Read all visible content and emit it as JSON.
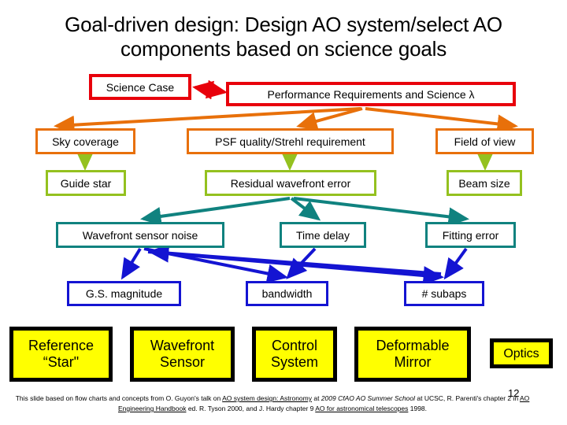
{
  "title": {
    "accent": "Goal-driven design:",
    "rest": " Design AO system/select AO components based on science goals"
  },
  "colors": {
    "red": "#E8000B",
    "orange": "#E8700A",
    "lime": "#94C11F",
    "teal": "#10827F",
    "blue": "#1414D2",
    "yellow_fill": "#FFFF00",
    "black": "#000000",
    "title_accent": "#8B1A12"
  },
  "flow": {
    "row1": [
      {
        "label": "Science Case",
        "color": "red"
      },
      {
        "label": "Performance Requirements and Science λ",
        "color": "red"
      }
    ],
    "row2": [
      {
        "label": "Sky coverage",
        "color": "orange"
      },
      {
        "label": "PSF quality/Strehl requirement",
        "color": "orange"
      },
      {
        "label": "Field of view",
        "color": "orange"
      }
    ],
    "row3": [
      {
        "label": "Guide star",
        "color": "lime"
      },
      {
        "label": "Residual wavefront error",
        "color": "lime"
      },
      {
        "label": "Beam size",
        "color": "lime"
      }
    ],
    "row4": [
      {
        "label": "Wavefront sensor noise",
        "color": "teal"
      },
      {
        "label": "Time delay",
        "color": "teal"
      },
      {
        "label": "Fitting error",
        "color": "teal"
      }
    ],
    "row5": [
      {
        "label": "G.S. magnitude",
        "color": "blue"
      },
      {
        "label": "bandwidth",
        "color": "blue"
      },
      {
        "label": "# subaps",
        "color": "blue"
      }
    ],
    "row6": [
      {
        "line1": "Reference",
        "line2": "“Star\""
      },
      {
        "line1": "Wavefront",
        "line2": "Sensor"
      },
      {
        "line1": "Control",
        "line2": "System"
      },
      {
        "line1": "Deformable",
        "line2": "Mirror"
      },
      {
        "line1": "Optics",
        "line2": ""
      }
    ]
  },
  "footer": {
    "s1": "This slide based on flow charts and concepts from O. Guyon's talk on ",
    "link1": "AO system design: Astronomy",
    "s2": " at ",
    "ital1": "2009 CfAO AO Summer School",
    "s3": " at UCSC, R. Parenti's chapter 2 in ",
    "link2": "AO Engineering Handbook",
    "s4": " ed. R. Tyson 2000, and J. Hardy chapter 9 ",
    "link3": "AO for astronomical telescopes",
    "s5": " 1998."
  },
  "page_number": "12"
}
